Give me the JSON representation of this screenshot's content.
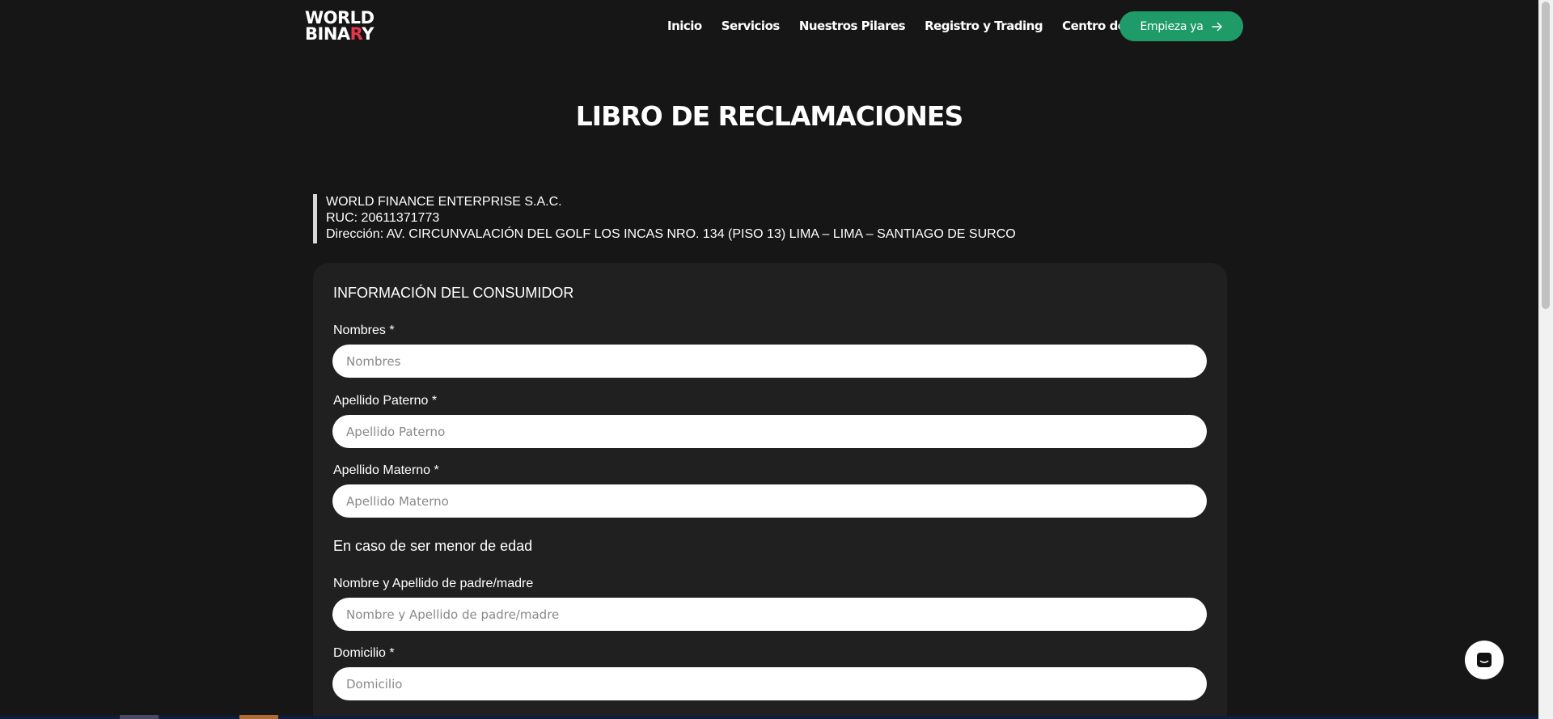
{
  "brand": {
    "logo_line1": "WORLD",
    "logo_line2_a": "BINA",
    "logo_line2_accent": "R",
    "logo_line2_b": "Y",
    "accent_color": "#e8354a"
  },
  "nav": {
    "items": [
      "Inicio",
      "Servicios",
      "Nuestros Pilares",
      "Registro y Trading",
      "Centro de Ayuda"
    ],
    "cta_label": "Empieza ya",
    "cta_icon": "arrow-right-icon",
    "cta_color": "#1f9b68"
  },
  "page": {
    "title": "LIBRO DE RECLAMACIONES"
  },
  "company": {
    "name": "WORLD FINANCE ENTERPRISE S.A.C.",
    "ruc": "RUC: 20611371773",
    "address": "Dirección: AV. CIRCUNVALACIÓN DEL GOLF LOS INCAS NRO. 134 (PISO 13) LIMA – LIMA – SANTIAGO DE SURCO"
  },
  "form": {
    "section_title": "INFORMACIÓN DEL CONSUMIDOR",
    "minor_title": "En caso de ser menor de edad",
    "fields": {
      "nombres": {
        "label": "Nombres *",
        "placeholder": "Nombres",
        "value": ""
      },
      "apellido_paterno": {
        "label": "Apellido Paterno *",
        "placeholder": "Apellido Paterno",
        "value": ""
      },
      "apellido_materno": {
        "label": "Apellido Materno *",
        "placeholder": "Apellido Materno",
        "value": ""
      },
      "padre_madre": {
        "label": "Nombre y Apellido de padre/madre",
        "placeholder": "Nombre y Apellido de padre/madre",
        "value": ""
      },
      "domicilio": {
        "label": "Domicilio *",
        "placeholder": "Domicilio",
        "value": ""
      }
    }
  },
  "widgets": {
    "chat_icon": "chat-icon"
  }
}
